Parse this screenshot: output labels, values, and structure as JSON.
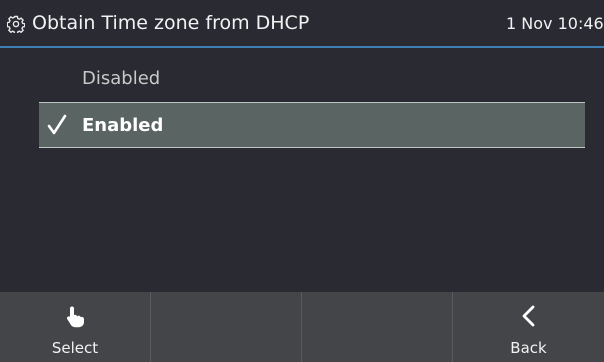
{
  "header": {
    "icon": "gear-icon",
    "title": "Obtain Time zone from DHCP",
    "clock": "1 Nov 10:46"
  },
  "options": [
    {
      "label": "Disabled",
      "selected": false
    },
    {
      "label": "Enabled",
      "selected": true,
      "icon": "checkmark-icon"
    }
  ],
  "softkeys": [
    {
      "label": "Select",
      "icon": "hand-pointer-icon"
    },
    {
      "label": ""
    },
    {
      "label": ""
    },
    {
      "label": "Back",
      "icon": "chevron-left-icon"
    }
  ],
  "colors": {
    "background": "#2a2a33",
    "header_divider": "#3e7fb6",
    "selected_row": "#5a6463",
    "softkey_bar": "#434549"
  }
}
